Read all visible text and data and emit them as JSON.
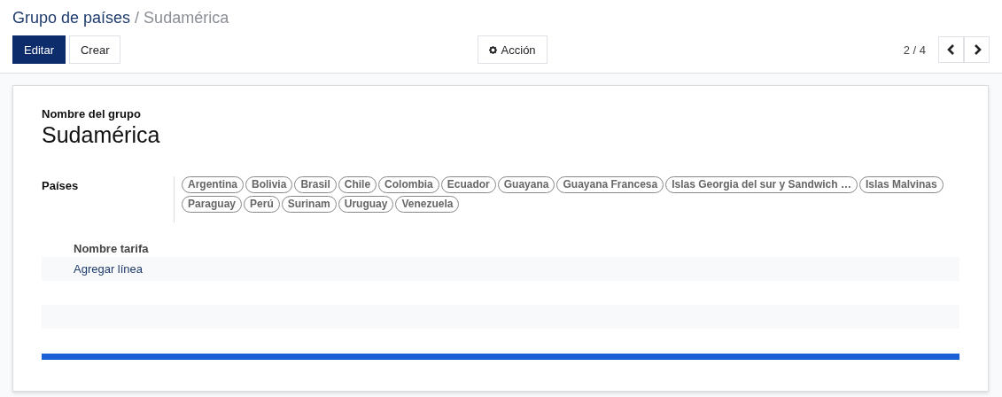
{
  "breadcrumb": {
    "parent": "Grupo de países",
    "separator": "/",
    "current": "Sudamérica"
  },
  "buttons": {
    "edit": "Editar",
    "create": "Crear",
    "action": "Acción"
  },
  "pager": {
    "value": "2 / 4"
  },
  "form": {
    "name_label": "Nombre del grupo",
    "name": "Sudamérica",
    "countries_label": "Países",
    "countries": [
      "Argentina",
      "Bolivia",
      "Brasil",
      "Chile",
      "Colombia",
      "Ecuador",
      "Guayana",
      "Guayana Francesa",
      "Islas Georgia del sur y Sandwich …",
      "Islas Malvinas",
      "Paraguay",
      "Perú",
      "Surinam",
      "Uruguay",
      "Venezuela"
    ],
    "table": {
      "column": "Nombre tarifa",
      "add_line": "Agregar línea"
    }
  }
}
